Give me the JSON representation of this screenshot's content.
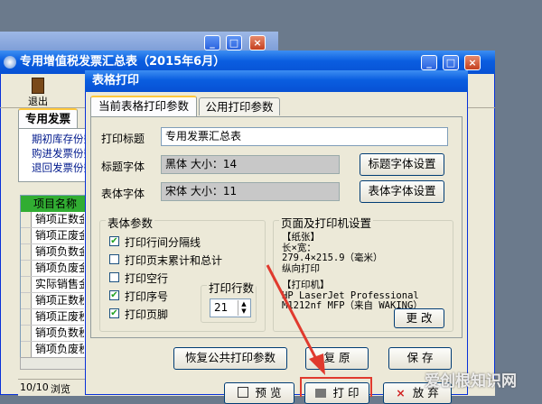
{
  "back_window": {
    "title": ""
  },
  "main_window": {
    "title": "专用增值税发票汇总表（2015年6月）",
    "toolbar_exit": "退出",
    "tab": "专用发票",
    "links": [
      "期初库存份数",
      "购进发票份数",
      "退回发票份数"
    ],
    "list_header": "项目名称",
    "list_rows": [
      "销项正数金额",
      "销项正废金额",
      "销项负数金额",
      "销项负废金额",
      "实际销售金额",
      "销项正数税额",
      "销项正废税额",
      "销项负数税额",
      "销项负废税额",
      "实际销项税额"
    ],
    "status_left": "10/10",
    "status_right": "浏览"
  },
  "dialog": {
    "title": "表格打印",
    "tabs": [
      "当前表格打印参数",
      "公用打印参数"
    ],
    "print_title_label": "打印标题",
    "print_title_value": "专用发票汇总表",
    "title_font_label": "标题字体",
    "title_font_value": "黑体  大小：14",
    "title_font_button": "标题字体设置",
    "body_font_label": "表体字体",
    "body_font_value": "宋体  大小：11",
    "body_font_button": "表体字体设置",
    "table_params": {
      "title": "表体参数",
      "options": [
        {
          "label": "打印行间分隔线",
          "checked": true
        },
        {
          "label": "打印页末累计和总计",
          "checked": false
        },
        {
          "label": "打印空行",
          "checked": false
        },
        {
          "label": "打印序号",
          "checked": true
        },
        {
          "label": "打印页脚",
          "checked": true
        }
      ],
      "rows_group_title": "打印行数",
      "rows_value": "21"
    },
    "page_settings": {
      "title": "页面及打印机设置",
      "paper_heading": "【纸张】",
      "paper_size_label": "长×宽：",
      "paper_size_value": "279.4×215.9（毫米）",
      "paper_orientation": "纵向打印",
      "printer_heading": "【打印机】",
      "printer_line1": "HP LaserJet Professional",
      "printer_line2": "M1212nf MFP（来自 WAKING）",
      "change_button": "更 改"
    },
    "restore_common_button": "恢复公共打印参数",
    "restore_button": "复 原",
    "save_button": "保 存",
    "preview_button": "预 览",
    "print_button": "打 印",
    "cancel_button": "放 弃"
  },
  "watermark": "爱创根知识网",
  "colors": {
    "titlebar": "#0a5ee0",
    "face": "#ece9d8",
    "highlight": "#e03a2e"
  }
}
